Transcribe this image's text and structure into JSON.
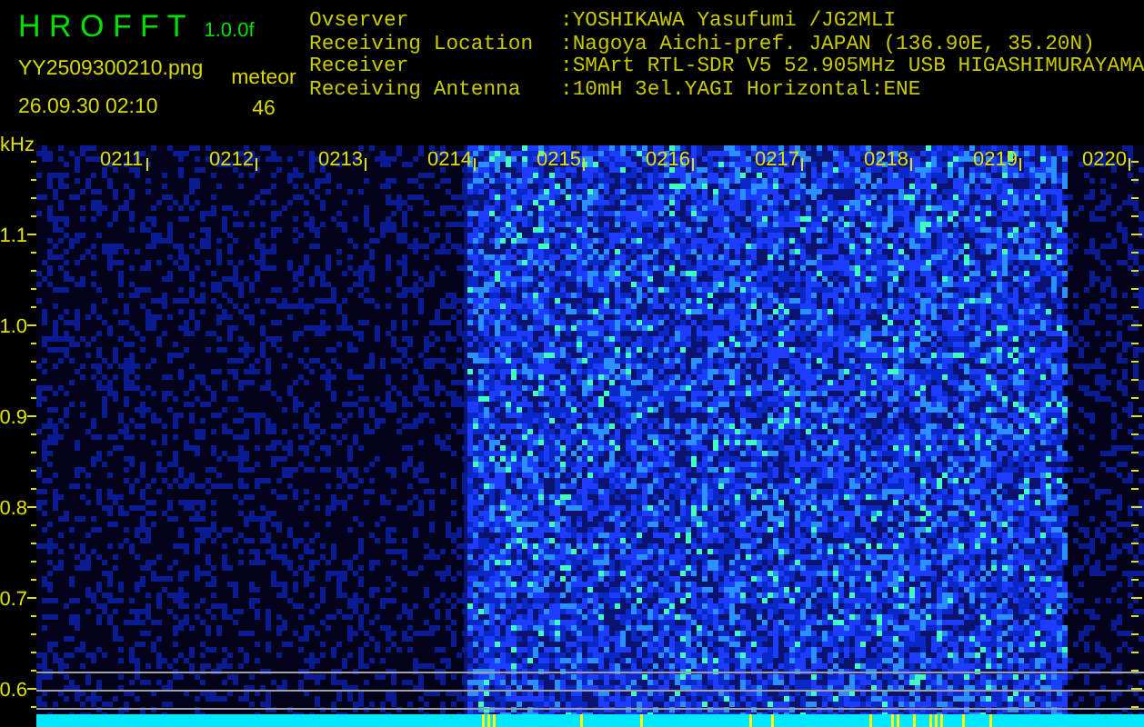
{
  "header": {
    "app_title": "H R O F F T",
    "version": "1.0.0f",
    "filename": "YY2509300210.png",
    "datetime": "26.09.30 02:10",
    "detection_label": "meteor",
    "count": "46"
  },
  "info": [
    {
      "label": "Ovserver",
      "value": ":YOSHIKAWA Yasufumi /JG2MLI"
    },
    {
      "label": "Receiving Location",
      "value": ":Nagoya Aichi-pref. JAPAN (136.90E, 35.20N)"
    },
    {
      "label": "Receiver",
      "value": ":SMArt RTL-SDR V5 52.905MHz USB HIGASHIMURAYAMA"
    },
    {
      "label": "Receiving Antenna",
      "value": ":10mH 3el.YAGI Horizontal:ENE"
    }
  ],
  "plot": {
    "y_unit": "kHz",
    "y_labels": [
      "1.1",
      "1.0",
      "0.9",
      "0.8",
      "0.7",
      "0.6"
    ],
    "time_labels": [
      "0211",
      "0212",
      "0213",
      "0214",
      "0215",
      "0216",
      "0217",
      "0218",
      "0219",
      "0220"
    ]
  }
}
